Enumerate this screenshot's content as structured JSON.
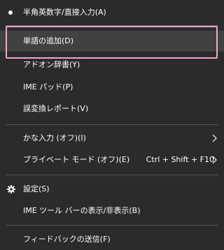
{
  "menu": {
    "items": [
      {
        "label": "半角英数字/直接入力(A)"
      },
      {
        "label": "単語の追加(D)"
      },
      {
        "label": "アドオン辞書(Y)"
      },
      {
        "label": "IME パッド(P)"
      },
      {
        "label": "誤変換レポート(V)"
      },
      {
        "label": "かな入力 (オフ)(I)"
      },
      {
        "label": "プライベート モード (オフ)(E)",
        "shortcut": "Ctrl + Shift + F10"
      },
      {
        "label": "設定(S)"
      },
      {
        "label": "IME ツール バーの表示/非表示(B)"
      },
      {
        "label": "フィードバックの送信(F)"
      }
    ]
  },
  "colors": {
    "background": "#2b2b2b",
    "hover": "#414141",
    "highlight_border": "#f3a4cf",
    "separator": "#545454",
    "text": "#ffffff"
  },
  "icons": {
    "selected": "bullet-icon",
    "submenu": "chevron-right-icon",
    "settings": "gear-icon"
  }
}
